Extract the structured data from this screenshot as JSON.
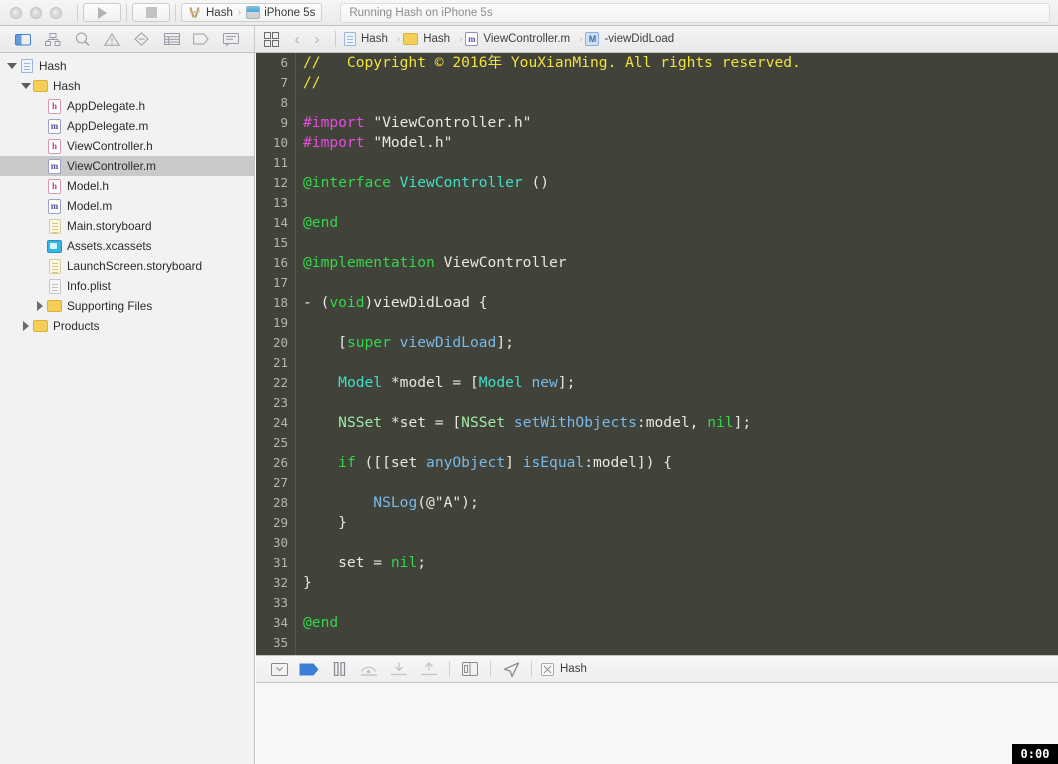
{
  "window": {
    "title": "Hash",
    "traffic_lights": [
      "close",
      "minimize",
      "zoom"
    ]
  },
  "toolbar": {
    "run_label": "Run",
    "stop_label": "Stop",
    "scheme_name": "Hash",
    "destination_name": "iPhone 5s",
    "scheme_separator": "›",
    "status_text": "Running Hash on iPhone 5s"
  },
  "navigator_tabs": [
    {
      "name": "project-navigator",
      "icon": "folder-icon",
      "active": true
    },
    {
      "name": "source-control-navigator",
      "icon": "hierarchy-icon",
      "active": false
    },
    {
      "name": "symbol-navigator",
      "icon": "search-icon",
      "active": false
    },
    {
      "name": "issue-navigator",
      "icon": "warning-triangle-icon",
      "active": false
    },
    {
      "name": "test-navigator",
      "icon": "diamond-icon",
      "active": false
    },
    {
      "name": "debug-navigator",
      "icon": "list-icon",
      "active": false
    },
    {
      "name": "breakpoint-navigator",
      "icon": "tag-icon",
      "active": false
    },
    {
      "name": "report-navigator",
      "icon": "speech-bubble-icon",
      "active": false
    }
  ],
  "jumpbar": {
    "back_label": "‹",
    "forward_label": "›",
    "separator": "›",
    "crumbs": [
      {
        "label": "Hash",
        "icon": "project-icon"
      },
      {
        "label": "Hash",
        "icon": "folder-icon"
      },
      {
        "label": "ViewController.m",
        "icon": "m-file-icon"
      },
      {
        "label": "-viewDidLoad",
        "icon": "method-icon"
      }
    ]
  },
  "sidebar": {
    "items": [
      {
        "label": "Hash",
        "indent": 0,
        "twisty": "down",
        "icon": "project-icon",
        "selected": false
      },
      {
        "label": "Hash",
        "indent": 1,
        "twisty": "down",
        "icon": "folder-icon",
        "selected": false
      },
      {
        "label": "AppDelegate.h",
        "indent": 2,
        "twisty": "none",
        "icon": "h-file-icon",
        "selected": false
      },
      {
        "label": "AppDelegate.m",
        "indent": 2,
        "twisty": "none",
        "icon": "m-file-icon",
        "selected": false
      },
      {
        "label": "ViewController.h",
        "indent": 2,
        "twisty": "none",
        "icon": "h-file-icon",
        "selected": false
      },
      {
        "label": "ViewController.m",
        "indent": 2,
        "twisty": "none",
        "icon": "m-file-icon",
        "selected": true
      },
      {
        "label": "Model.h",
        "indent": 2,
        "twisty": "none",
        "icon": "h-file-icon",
        "selected": false
      },
      {
        "label": "Model.m",
        "indent": 2,
        "twisty": "none",
        "icon": "m-file-icon",
        "selected": false
      },
      {
        "label": "Main.storyboard",
        "indent": 2,
        "twisty": "none",
        "icon": "storyboard-icon",
        "selected": false
      },
      {
        "label": "Assets.xcassets",
        "indent": 2,
        "twisty": "none",
        "icon": "assets-icon",
        "selected": false
      },
      {
        "label": "LaunchScreen.storyboard",
        "indent": 2,
        "twisty": "none",
        "icon": "storyboard-icon",
        "selected": false
      },
      {
        "label": "Info.plist",
        "indent": 2,
        "twisty": "none",
        "icon": "plist-icon",
        "selected": false
      },
      {
        "label": "Supporting Files",
        "indent": 2,
        "twisty": "right",
        "icon": "folder-icon",
        "selected": false
      },
      {
        "label": "Products",
        "indent": 1,
        "twisty": "right",
        "icon": "folder-icon",
        "selected": false
      }
    ]
  },
  "editor": {
    "language": "objective-c",
    "first_line_number": 6,
    "lines": [
      {
        "n": 6,
        "tokens": [
          {
            "t": "//   Copyright © 2016年 YouXianMing. All rights reserved.",
            "c": "c-comment"
          }
        ]
      },
      {
        "n": 7,
        "tokens": [
          {
            "t": "//",
            "c": "c-comment"
          }
        ]
      },
      {
        "n": 8,
        "tokens": []
      },
      {
        "n": 9,
        "tokens": [
          {
            "t": "#import",
            "c": "c-pre"
          },
          {
            "t": " ",
            "c": "c-plain"
          },
          {
            "t": "\"ViewController.h\"",
            "c": "c-str"
          }
        ]
      },
      {
        "n": 10,
        "tokens": [
          {
            "t": "#import",
            "c": "c-pre"
          },
          {
            "t": " ",
            "c": "c-plain"
          },
          {
            "t": "\"Model.h\"",
            "c": "c-str"
          }
        ]
      },
      {
        "n": 11,
        "tokens": []
      },
      {
        "n": 12,
        "tokens": [
          {
            "t": "@interface",
            "c": "c-kw"
          },
          {
            "t": " ",
            "c": "c-plain"
          },
          {
            "t": "ViewController",
            "c": "c-type"
          },
          {
            "t": " ()",
            "c": "c-plain"
          }
        ]
      },
      {
        "n": 13,
        "tokens": []
      },
      {
        "n": 14,
        "tokens": [
          {
            "t": "@end",
            "c": "c-kw"
          }
        ]
      },
      {
        "n": 15,
        "tokens": []
      },
      {
        "n": 16,
        "tokens": [
          {
            "t": "@implementation",
            "c": "c-kw"
          },
          {
            "t": " ViewController",
            "c": "c-plain"
          }
        ]
      },
      {
        "n": 17,
        "tokens": []
      },
      {
        "n": 18,
        "tokens": [
          {
            "t": "- (",
            "c": "c-plain"
          },
          {
            "t": "void",
            "c": "c-kw"
          },
          {
            "t": ")viewDidLoad {",
            "c": "c-plain"
          }
        ]
      },
      {
        "n": 19,
        "tokens": []
      },
      {
        "n": 20,
        "tokens": [
          {
            "t": "    [",
            "c": "c-plain"
          },
          {
            "t": "super",
            "c": "c-kw"
          },
          {
            "t": " ",
            "c": "c-plain"
          },
          {
            "t": "viewDidLoad",
            "c": "c-call"
          },
          {
            "t": "];",
            "c": "c-plain"
          }
        ]
      },
      {
        "n": 21,
        "tokens": []
      },
      {
        "n": 22,
        "tokens": [
          {
            "t": "    ",
            "c": "c-plain"
          },
          {
            "t": "Model",
            "c": "c-type"
          },
          {
            "t": " *model = [",
            "c": "c-plain"
          },
          {
            "t": "Model",
            "c": "c-type"
          },
          {
            "t": " ",
            "c": "c-plain"
          },
          {
            "t": "new",
            "c": "c-call"
          },
          {
            "t": "];",
            "c": "c-plain"
          }
        ]
      },
      {
        "n": 23,
        "tokens": []
      },
      {
        "n": 24,
        "tokens": [
          {
            "t": "    ",
            "c": "c-plain"
          },
          {
            "t": "NSSet",
            "c": "c-proj"
          },
          {
            "t": " *set = [",
            "c": "c-plain"
          },
          {
            "t": "NSSet",
            "c": "c-proj"
          },
          {
            "t": " ",
            "c": "c-plain"
          },
          {
            "t": "setWithObjects",
            "c": "c-call"
          },
          {
            "t": ":model, ",
            "c": "c-plain"
          },
          {
            "t": "nil",
            "c": "c-kw"
          },
          {
            "t": "];",
            "c": "c-plain"
          }
        ]
      },
      {
        "n": 25,
        "tokens": []
      },
      {
        "n": 26,
        "tokens": [
          {
            "t": "    ",
            "c": "c-plain"
          },
          {
            "t": "if",
            "c": "c-kw"
          },
          {
            "t": " ([[set ",
            "c": "c-plain"
          },
          {
            "t": "anyObject",
            "c": "c-call"
          },
          {
            "t": "] ",
            "c": "c-plain"
          },
          {
            "t": "isEqual",
            "c": "c-call"
          },
          {
            "t": ":model]) {",
            "c": "c-plain"
          }
        ]
      },
      {
        "n": 27,
        "tokens": []
      },
      {
        "n": 28,
        "tokens": [
          {
            "t": "        ",
            "c": "c-plain"
          },
          {
            "t": "NSLog",
            "c": "c-call"
          },
          {
            "t": "(@\"A\");",
            "c": "c-plain"
          }
        ]
      },
      {
        "n": 29,
        "tokens": [
          {
            "t": "    }",
            "c": "c-plain"
          }
        ]
      },
      {
        "n": 30,
        "tokens": []
      },
      {
        "n": 31,
        "tokens": [
          {
            "t": "    set = ",
            "c": "c-plain"
          },
          {
            "t": "nil",
            "c": "c-kw"
          },
          {
            "t": ";",
            "c": "c-plain"
          }
        ]
      },
      {
        "n": 32,
        "tokens": [
          {
            "t": "}",
            "c": "c-plain"
          }
        ]
      },
      {
        "n": 33,
        "tokens": []
      },
      {
        "n": 34,
        "tokens": [
          {
            "t": "@end",
            "c": "c-kw"
          }
        ]
      },
      {
        "n": 35,
        "tokens": []
      }
    ]
  },
  "debugbar": {
    "buttons": [
      {
        "name": "hide-console-button",
        "icon": "hide-console-icon",
        "state": "normal"
      },
      {
        "name": "breakpoints-toggle",
        "icon": "breakpoint-icon",
        "state": "on"
      },
      {
        "name": "pause-button",
        "icon": "pause-icon",
        "state": "normal"
      },
      {
        "name": "step-over-button",
        "icon": "step-over-icon",
        "state": "disabled"
      },
      {
        "name": "step-into-button",
        "icon": "step-into-icon",
        "state": "disabled"
      },
      {
        "name": "step-out-button",
        "icon": "step-out-icon",
        "state": "disabled"
      },
      {
        "name": "view-hierarchy-button",
        "icon": "view-debug-icon",
        "state": "normal"
      },
      {
        "name": "simulate-location-button",
        "icon": "location-arrow-icon",
        "state": "normal"
      }
    ],
    "process_label": "Hash"
  },
  "time_badge": {
    "label": "0:00"
  },
  "colors": {
    "editor_background": "#41423a",
    "accent_blue": "#3b7fd4",
    "selection_gray": "#c9c9c9",
    "comment_yellow": "#f3e23c",
    "keyword_green": "#32d74b",
    "type_cyan": "#3fe0c8",
    "call_blue": "#7ab9e8",
    "preprocessor_magenta": "#e84be0"
  }
}
